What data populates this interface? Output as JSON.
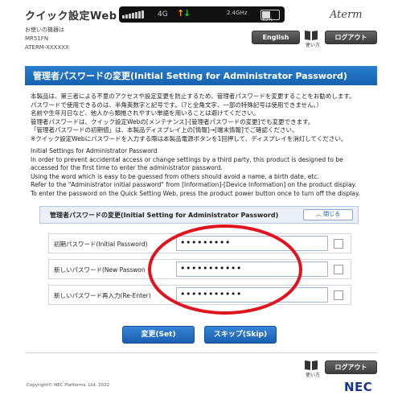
{
  "header": {
    "app_title": "クイック設定Web",
    "brand": "Aterm",
    "device_label": "お使いの機器は",
    "device_model": "MR51FN",
    "device_ssid": "ATERM-XXXXXX"
  },
  "status": {
    "signal_icon": "signal-bars-icon",
    "network": "4G",
    "frequency": "2.4GHz",
    "battery_icon": "battery-icon",
    "battery_text": "52%"
  },
  "toolbar": {
    "english_label": "English",
    "manual_label": "使い方",
    "logout_label": "ログアウト"
  },
  "page": {
    "title": "管理者パスワードの変更(Initial Setting for Administrator Password)"
  },
  "description_ja": [
    "本製品は、第三者による不意のアクセスや設定変更を防止するため、管理者パスワードを変更することをお勧めします。",
    "パスワードで使用できるのは、半角英数字と記号です。（?と全角文字、一部の特殊記号は使用できません。）",
    "名前や生年月日など、他人から類推されやすい単語を用いることは避けてください。",
    "管理者パスワードは、クイック設定Webの[メンテナンス]-[管理者パスワードの変更]でも変更できます。",
    "「管理者パスワードの初期値」は、本製品ディスプレイ上の[情報]→[端末情報]でご確認ください。",
    "※クイック設定Webにパスワードを入力する際は本製品電源ボタンを1回押して、ディスプレイを消灯してください。"
  ],
  "description_en": [
    "Initial Settings for Administrator Password",
    "In order to prevent accidental access or change settings by a third party, this product is designed to be",
    "accessed for the first time to enter the administrator password.",
    "Using the word which is easy to be guessed from others should avoid a name, a birth date, etc.",
    "Refer to the \"Administrator initial password\" from [Information]-[Device Information] on the product display.",
    "To enter the password on the Quick Setting Web, press the product power button once to turn off the display."
  ],
  "panel": {
    "title": "管理者パスワードの変更(Initial Setting for Administrator Password)",
    "close_label": "閉じる",
    "fields": [
      {
        "label": "初期パスワード(Initial Password)",
        "value": "•••••••••"
      },
      {
        "label": "新しいパスワード(New Passwon",
        "value": "•••••••••••"
      },
      {
        "label": "新しいパスワード再入力(Re-Enter)",
        "value": "•••••••••••"
      }
    ]
  },
  "actions": {
    "set_label": "変更(Set)",
    "skip_label": "スキップ(Skip)"
  },
  "footer": {
    "manual_label": "使い方",
    "logout_label": "ログアウト",
    "copyright": "Copyright© NEC Platforms, Ltd. 2022",
    "logo": "NEC"
  },
  "colors": {
    "title_bar": "#1f6fc4",
    "annotation_circle": "#e0141e",
    "nec_blue": "#15348f"
  }
}
